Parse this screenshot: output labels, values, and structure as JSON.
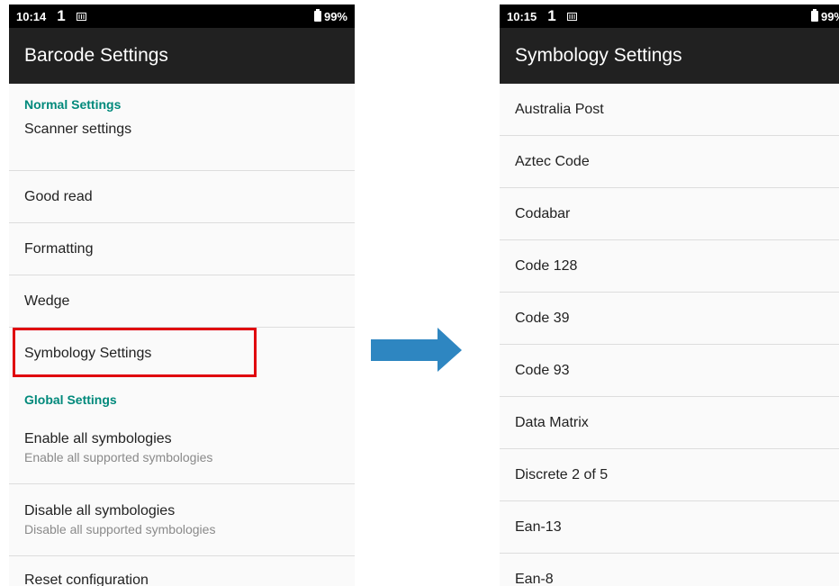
{
  "left_screen": {
    "status": {
      "time": "10:14",
      "notif": "1",
      "battery": "99%"
    },
    "appbar_title": "Barcode Settings",
    "normal_category": "Normal Settings",
    "normal_items": [
      "Scanner settings",
      "Good read",
      "Formatting",
      "Wedge",
      "Symbology Settings"
    ],
    "global_category": "Global Settings",
    "global_items": [
      {
        "title": "Enable all symbologies",
        "summary": "Enable all supported symbologies"
      },
      {
        "title": "Disable all symbologies",
        "summary": "Disable all supported symbologies"
      },
      {
        "title": "Reset configuration"
      }
    ]
  },
  "right_screen": {
    "status": {
      "time": "10:15",
      "notif": "1",
      "battery": "99%"
    },
    "appbar_title": "Symbology Settings",
    "items": [
      "Australia Post",
      "Aztec Code",
      "Codabar",
      "Code 128",
      "Code 39",
      "Code 93",
      "Data Matrix",
      "Discrete 2 of 5",
      "Ean-13",
      "Ean-8"
    ]
  },
  "colors": {
    "accent": "#00897b",
    "appbar": "#212121",
    "highlight": "#e0000e",
    "arrow": "#2e86c1"
  },
  "icons": {
    "transition_arrow": "arrow-right-icon",
    "battery": "battery-icon"
  }
}
